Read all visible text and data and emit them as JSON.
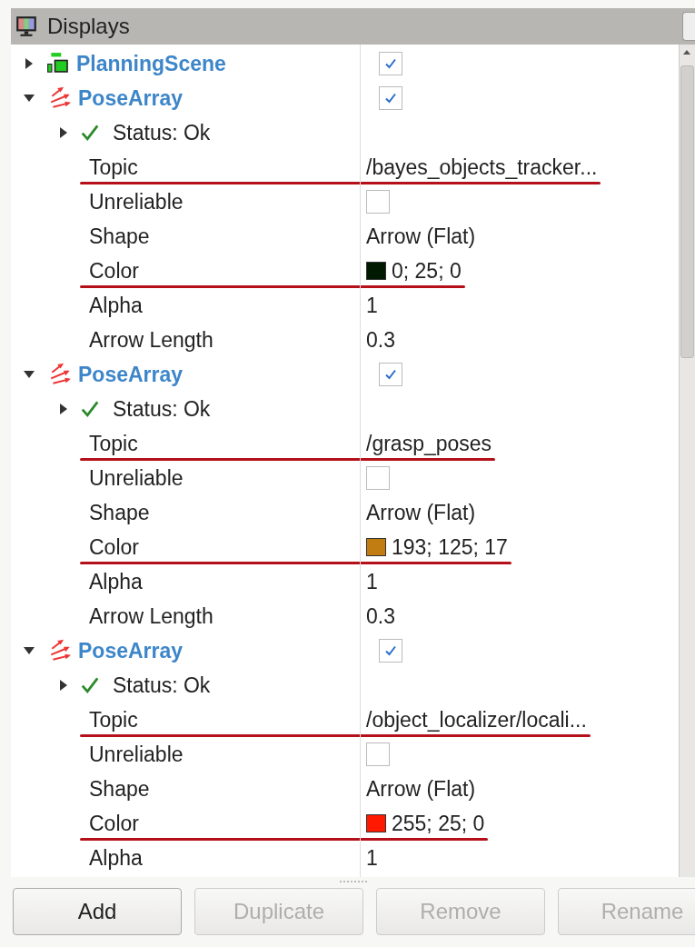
{
  "panel": {
    "title": "Displays"
  },
  "displays": [
    {
      "kind": "planning_scene",
      "name": "PlanningScene",
      "expanded": false,
      "enabled": true
    },
    {
      "kind": "pose_array",
      "name": "PoseArray",
      "expanded": true,
      "enabled": true,
      "status": {
        "text": "Status: Ok",
        "expanded": false
      },
      "properties": [
        {
          "kind": "text",
          "label": "Topic",
          "value": "/bayes_objects_tracker...",
          "underlined": true
        },
        {
          "kind": "checkbox",
          "label": "Unreliable",
          "checked": false,
          "underlined": false
        },
        {
          "kind": "text",
          "label": "Shape",
          "value": "Arrow (Flat)",
          "underlined": false
        },
        {
          "kind": "color",
          "label": "Color",
          "value": "0; 25; 0",
          "color": "#001900",
          "underlined": true
        },
        {
          "kind": "text",
          "label": "Alpha",
          "value": "1",
          "underlined": false
        },
        {
          "kind": "text",
          "label": "Arrow Length",
          "value": "0.3",
          "underlined": false
        }
      ]
    },
    {
      "kind": "pose_array",
      "name": "PoseArray",
      "expanded": true,
      "enabled": true,
      "status": {
        "text": "Status: Ok",
        "expanded": false
      },
      "properties": [
        {
          "kind": "text",
          "label": "Topic",
          "value": "/grasp_poses",
          "underlined": true
        },
        {
          "kind": "checkbox",
          "label": "Unreliable",
          "checked": false,
          "underlined": false
        },
        {
          "kind": "text",
          "label": "Shape",
          "value": "Arrow (Flat)",
          "underlined": false
        },
        {
          "kind": "color",
          "label": "Color",
          "value": "193; 125; 17",
          "color": "#c17d11",
          "underlined": true
        },
        {
          "kind": "text",
          "label": "Alpha",
          "value": "1",
          "underlined": false
        },
        {
          "kind": "text",
          "label": "Arrow Length",
          "value": "0.3",
          "underlined": false
        }
      ]
    },
    {
      "kind": "pose_array",
      "name": "PoseArray",
      "expanded": true,
      "enabled": true,
      "status": {
        "text": "Status: Ok",
        "expanded": false
      },
      "properties": [
        {
          "kind": "text",
          "label": "Topic",
          "value": "/object_localizer/locali...",
          "underlined": true
        },
        {
          "kind": "checkbox",
          "label": "Unreliable",
          "checked": false,
          "underlined": false
        },
        {
          "kind": "text",
          "label": "Shape",
          "value": "Arrow (Flat)",
          "underlined": false
        },
        {
          "kind": "color",
          "label": "Color",
          "value": "255; 25; 0",
          "color": "#ff1900",
          "underlined": true
        },
        {
          "kind": "text",
          "label": "Alpha",
          "value": "1",
          "underlined": false
        }
      ]
    }
  ],
  "buttons": [
    {
      "label": "Add",
      "disabled": false
    },
    {
      "label": "Duplicate",
      "disabled": true
    },
    {
      "label": "Remove",
      "disabled": true
    },
    {
      "label": "Rename",
      "disabled": true
    }
  ]
}
